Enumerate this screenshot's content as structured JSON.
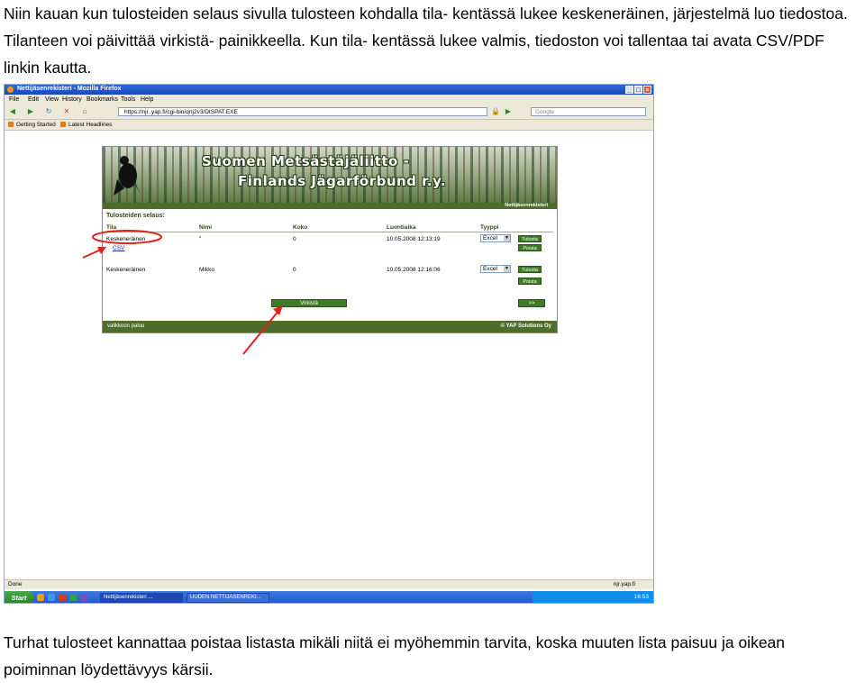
{
  "doc": {
    "intro": "Niin kauan kun tulosteiden selaus sivulla tulosteen kohdalla tila- kentässä lukee keskeneräinen, järjestelmä luo tiedostoa. Tilanteen voi päivittää virkistä- painikkeella. Kun tila- kentässä lukee valmis, tiedoston voi tallentaa tai avata CSV/PDF linkin kautta.",
    "outro": "Turhat tulosteet kannattaa poistaa listasta mikäli niitä ei myöhemmin tarvita, koska muuten lista paisuu ja oikean poiminnan löydettävyys kärsii."
  },
  "browser": {
    "title": "Nettijäsenrekisteri - Mozilla Firefox",
    "menu": [
      "File",
      "Edit",
      "View",
      "History",
      "Bookmarks",
      "Tools",
      "Help"
    ],
    "url": "https://njr..yap.fi/cgi-bin/qnj2v3/DISPAT.EXE",
    "search_placeholder": "Google",
    "bookmarks": [
      "Getting Started",
      "Latest Headlines"
    ],
    "status": "Done",
    "status_right": "njr.yap.fi"
  },
  "page": {
    "banner_line1": "Suomen Metsästäjäliitto -",
    "banner_line2": "Finlands Jägarförbund r.y.",
    "userbar": "Nettijäsenrekisteri",
    "section_title": "Tulosteiden selaus:",
    "columns": [
      "Tila",
      "Nimi",
      "Koko",
      "Luontiaika",
      "Tyyppi"
    ],
    "rows": [
      {
        "tila": "Keskeneräinen",
        "link": "CSV",
        "nimi": "\"",
        "koko": "0",
        "luontiaika": "10.05.2008 12:13:19",
        "tyyppi": "Excel",
        "btn1": "Tulosta",
        "btn2": "Poista"
      },
      {
        "tila": "Keskeneräinen",
        "nimi": "Mikko",
        "koko": "0",
        "luontiaika": "10.05.2008 12:16:06",
        "tyyppi": "Excel",
        "btn1": "Tulosta",
        "btn2": "Poista"
      }
    ],
    "refresh_button": "Virkistä",
    "next_button": ">>",
    "back_link": "valikkoon paluu",
    "copyright": "© YAP Solutions Oy"
  },
  "taskbar": {
    "start": "Start",
    "tasks": [
      "Nettijäsenrekisteri ...",
      "UUDEN NETTIJÄSENREKI..."
    ],
    "time": "16:53"
  },
  "colors": {
    "annotation": "#e0201c",
    "green": "#3e7a28"
  }
}
